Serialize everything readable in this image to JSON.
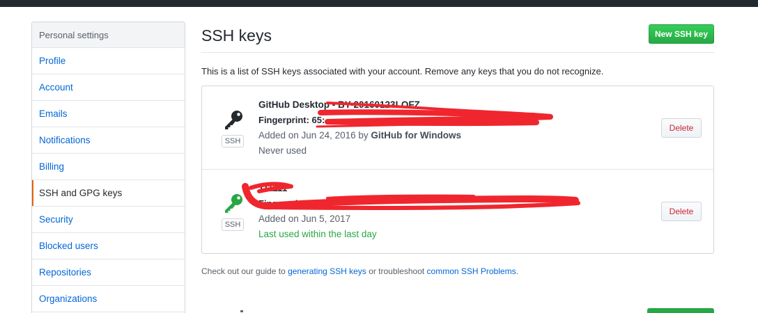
{
  "sidebar": {
    "heading": "Personal settings",
    "items": [
      {
        "label": "Profile"
      },
      {
        "label": "Account"
      },
      {
        "label": "Emails"
      },
      {
        "label": "Notifications"
      },
      {
        "label": "Billing"
      },
      {
        "label": "SSH and GPG keys",
        "selected": true
      },
      {
        "label": "Security"
      },
      {
        "label": "Blocked users"
      },
      {
        "label": "Repositories"
      },
      {
        "label": "Organizations"
      }
    ]
  },
  "main": {
    "title": "SSH keys",
    "new_key_button": "New SSH key",
    "intro": "This is a list of SSH keys associated with your account. Remove any keys that you do not recognize.",
    "keys": [
      {
        "title": "GitHub Desktop - BY-20160123LOFZ",
        "fingerprint_label": "Fingerprint: 65:",
        "added_prefix": "Added on Jun 24, 2016 by ",
        "added_by": "GitHub for Windows",
        "usage": "Never used",
        "badge": "SSH",
        "delete_label": "Delete",
        "icon": "key-icon",
        "icon_color": "#24292e"
      },
      {
        "title": "111111",
        "fingerprint_label": "Fingerprint: 5f:",
        "added_prefix": "Added on Jun 5, 2017",
        "usage": "Last used within the last day",
        "badge": "SSH",
        "delete_label": "Delete",
        "icon": "key-icon",
        "icon_color": "#28a745"
      }
    ],
    "help": {
      "prefix": "Check out our guide to ",
      "link1": "generating SSH keys",
      "middle": " or troubleshoot ",
      "link2": "common SSH Problems",
      "suffix": "."
    }
  },
  "colors": {
    "primary_green": "#28a745",
    "link_blue": "#0366d6",
    "danger_red": "#cb2431",
    "selected_accent": "#e36209",
    "redaction_red": "#f0262e"
  }
}
